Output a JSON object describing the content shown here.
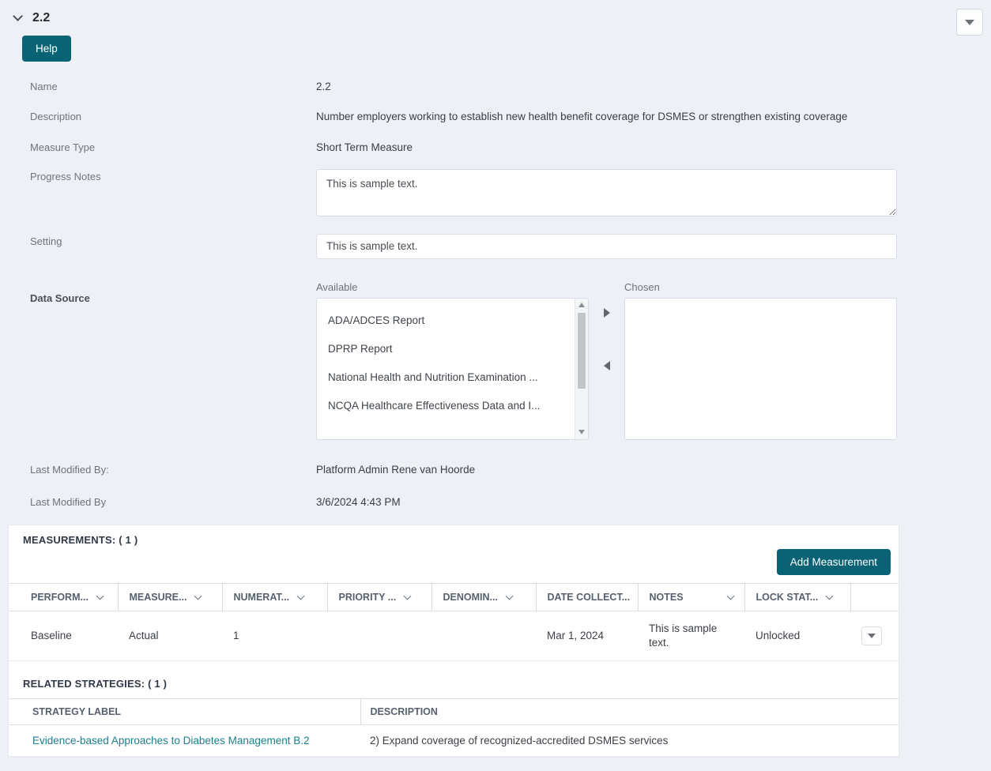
{
  "window": {
    "title": "2.2"
  },
  "buttons": {
    "help": "Help"
  },
  "form": {
    "name": {
      "label": "Name",
      "value": "2.2"
    },
    "description": {
      "label": "Description",
      "value": "Number employers working to establish new health benefit coverage for DSMES or strengthen existing coverage"
    },
    "measure_type": {
      "label": "Measure Type",
      "value": "Short Term Measure"
    },
    "progress_notes": {
      "label": "Progress Notes",
      "value": "This is sample text."
    },
    "setting": {
      "label": "Setting",
      "value": "This is sample text."
    },
    "data_source": {
      "label": "Data Source",
      "available": {
        "label": "Available",
        "items": [
          "ADA/ADCES Report",
          "DPRP Report",
          "National Health and Nutrition Examination ...",
          "NCQA Healthcare Effectiveness Data and I..."
        ]
      },
      "chosen": {
        "label": "Chosen",
        "items": []
      }
    },
    "last_modified_by_name": {
      "label": "Last Modified By:",
      "value": "Platform Admin Rene van Hoorde"
    },
    "last_modified_by_date": {
      "label": "Last Modified By",
      "value": "3/6/2024 4:43 PM"
    }
  },
  "measurements": {
    "title": "MEASUREMENTS: ( 1 )",
    "add_button": "Add Measurement",
    "headers": [
      "PERFORM...",
      "MEASURE...",
      "NUMERAT...",
      "PRIORITY ...",
      "DENOMIN...",
      "DATE COLLECT...",
      "NOTES",
      "LOCK STAT..."
    ],
    "row": {
      "performance": "Baseline",
      "measure": "Actual",
      "numerator": "1",
      "priority": "",
      "denominator": "",
      "date_collected": "Mar 1, 2024",
      "notes": "This is sample text.",
      "lock_status": "Unlocked"
    }
  },
  "related_strategies": {
    "title": "RELATED STRATEGIES: ( 1 )",
    "headers": {
      "label": "STRATEGY LABEL",
      "description": "DESCRIPTION"
    },
    "row": {
      "label": "Evidence-based Approaches to Diabetes Management B.2",
      "description": "2) Expand coverage of recognized-accredited DSMES services"
    }
  },
  "colors": {
    "accent_teal": "#0a6374",
    "link_teal": "#1b7f8e",
    "page_background": "#edf1f5"
  }
}
